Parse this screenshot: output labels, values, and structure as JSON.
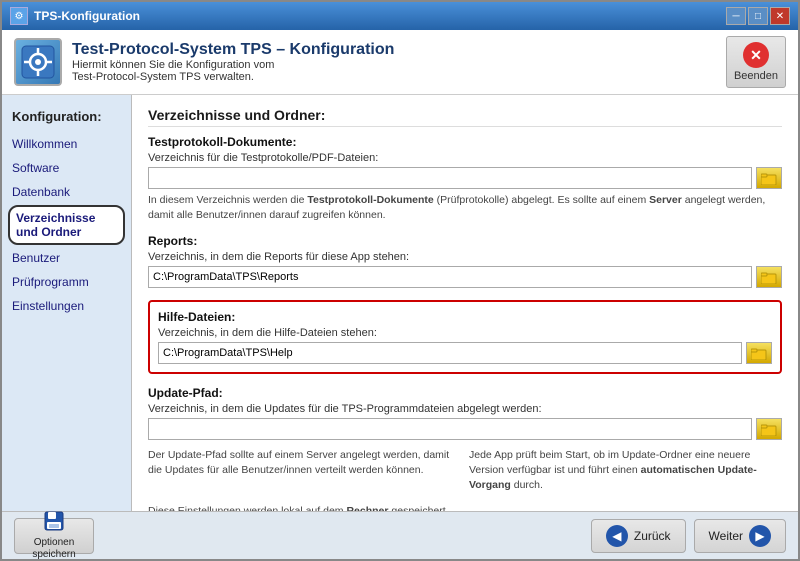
{
  "window": {
    "title": "TPS-Konfiguration",
    "title_bar_buttons": [
      "minimize",
      "maximize",
      "close"
    ]
  },
  "header": {
    "icon_label": "⚙",
    "title": "Test-Protocol-System TPS – Konfiguration",
    "subtitle_line1": "Hiermit können Sie die Konfiguration vom",
    "subtitle_line2": "Test-Protocol-System TPS verwalten.",
    "end_button_label": "Beenden",
    "end_button_icon": "✕"
  },
  "sidebar": {
    "title": "Konfiguration:",
    "items": [
      {
        "id": "willkommen",
        "label": "Willkommen",
        "active": false,
        "outlined": false
      },
      {
        "id": "software",
        "label": "Software",
        "active": false,
        "outlined": false
      },
      {
        "id": "datenbank",
        "label": "Datenbank",
        "active": false,
        "outlined": false
      },
      {
        "id": "verzeichnisse",
        "label": "Verzeichnisse und Ordner",
        "active": false,
        "outlined": true
      },
      {
        "id": "benutzer",
        "label": "Benutzer",
        "active": false,
        "outlined": false
      },
      {
        "id": "pruefprogramm",
        "label": "Prüfprogramm",
        "active": false,
        "outlined": false
      },
      {
        "id": "einstellungen",
        "label": "Einstellungen",
        "active": false,
        "outlined": false
      }
    ]
  },
  "main": {
    "section_title": "Verzeichnisse und Ordner:",
    "testprotokoll": {
      "title": "Testprotokoll-Dokumente:",
      "field_label": "Verzeichnis für die Testprotokolle/PDF-Dateien:",
      "value": "",
      "info": "In diesem Verzeichnis werden die <b>Testprotokoll-Dokumente</b> (Prüfprotokolle) abgelegt. Es sollte auf einem <b>Server</b> angelegt werden, damit alle Benutzer/innen darauf zugreifen können."
    },
    "reports": {
      "title": "Reports:",
      "field_label": "Verzeichnis, in dem die Reports für diese App stehen:",
      "value": "C:\\ProgramData\\TPS\\Reports"
    },
    "hilfe": {
      "title": "Hilfe-Dateien:",
      "field_label": "Verzeichnis, in dem die Hilfe-Dateien stehen:",
      "value": "C:\\ProgramData\\TPS\\Help"
    },
    "update": {
      "title": "Update-Pfad:",
      "field_label": "Verzeichnis, in dem die Updates für die TPS-Programmdateien abgelegt werden:",
      "value": "",
      "info_left": "Der Update-Pfad sollte auf einem Server angelegt werden, damit die Updates für alle Benutzer/innen verteilt werden können.",
      "info_right": "Jede App prüft beim Start, ob im Update-Ordner eine neuere Version verfügbar ist und führt einen <b>automatischen Update-Vorgang</b> durch."
    },
    "footer_info": "Diese Einstellungen werden lokal auf dem <b>Rechner</b> gespeichert."
  },
  "footer": {
    "save_label": "Optionen\nspeichern",
    "save_icon": "💾",
    "back_label": "Zurück",
    "next_label": "Weiter",
    "back_arrow": "◀",
    "next_arrow": "▶"
  }
}
